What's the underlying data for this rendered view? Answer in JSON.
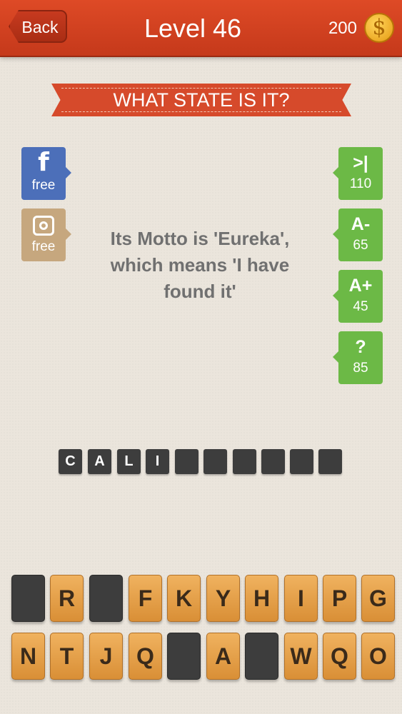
{
  "header": {
    "back_label": "Back",
    "title": "Level 46",
    "coins": "200",
    "coin_symbol": "$"
  },
  "question": {
    "banner": "WHAT STATE IS IT?",
    "clue": "Its Motto is 'Eureka', which means 'I have found it'"
  },
  "left_buttons": [
    {
      "icon": "facebook-icon",
      "glyph": "f",
      "label": "free",
      "color": "#4c6fb9"
    },
    {
      "icon": "instagram-icon",
      "label": "free",
      "color": "#c6a77e"
    }
  ],
  "hint_buttons": [
    {
      "glyph": ">|",
      "cost": "110"
    },
    {
      "glyph": "A-",
      "cost": "65"
    },
    {
      "glyph": "A+",
      "cost": "45"
    },
    {
      "glyph": "?",
      "cost": "85"
    }
  ],
  "answer_slots": [
    "C",
    "A",
    "L",
    "I",
    "",
    "",
    "",
    "",
    "",
    ""
  ],
  "letter_tiles": {
    "row1": [
      "",
      "R",
      "",
      "F",
      "K",
      "Y",
      "H",
      "I",
      "P",
      "G"
    ],
    "row2": [
      "N",
      "T",
      "J",
      "Q",
      "",
      "A",
      "",
      "W",
      "Q",
      "O"
    ]
  },
  "colors": {
    "header_red": "#d4411f",
    "hint_green": "#6cb946",
    "tile_tan": "#e6a04a",
    "slot_dark": "#3d3d3d"
  }
}
